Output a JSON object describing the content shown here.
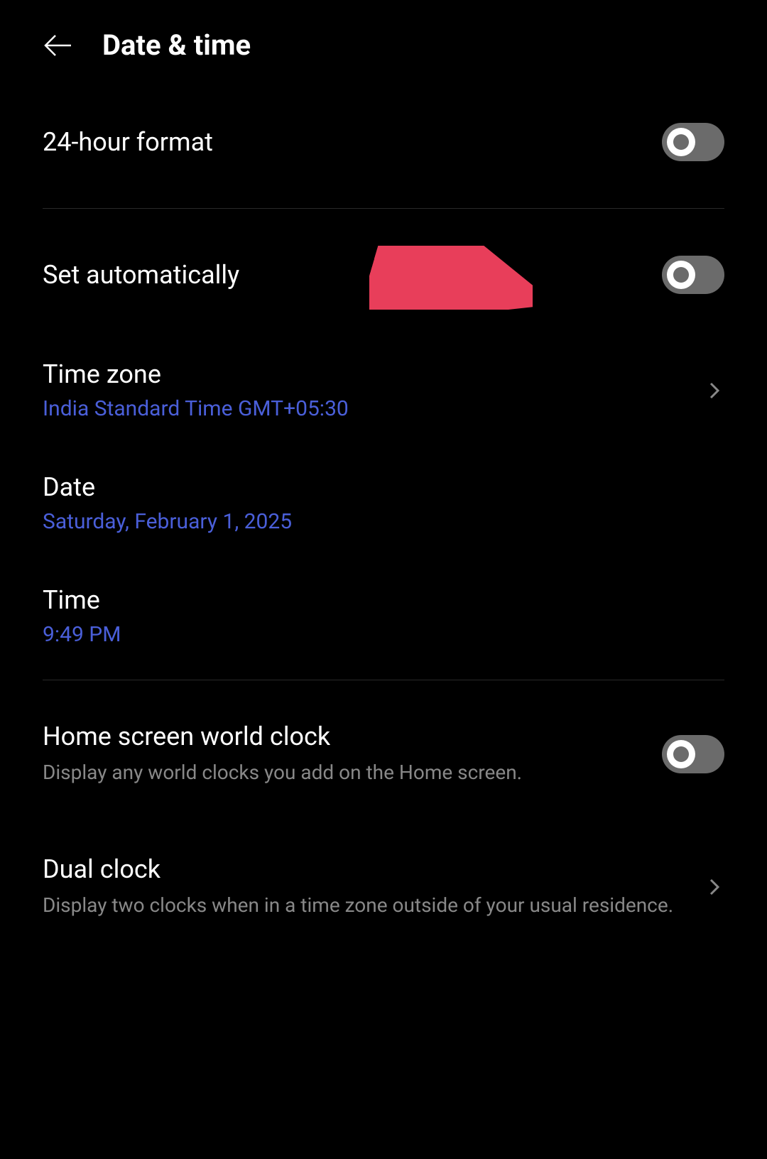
{
  "header": {
    "title": "Date & time"
  },
  "rows": {
    "hour24": {
      "label": "24-hour format"
    },
    "setAuto": {
      "label": "Set automatically"
    },
    "timezone": {
      "label": "Time zone",
      "value": "India Standard Time GMT+05:30"
    },
    "date": {
      "label": "Date",
      "value": "Saturday, February 1, 2025"
    },
    "time": {
      "label": "Time",
      "value": "9:49 PM"
    },
    "worldClock": {
      "label": "Home screen world clock",
      "desc": "Display any world clocks you add on the Home screen."
    },
    "dualClock": {
      "label": "Dual clock",
      "desc": "Display two clocks when in a time zone outside of your usual residence."
    }
  }
}
